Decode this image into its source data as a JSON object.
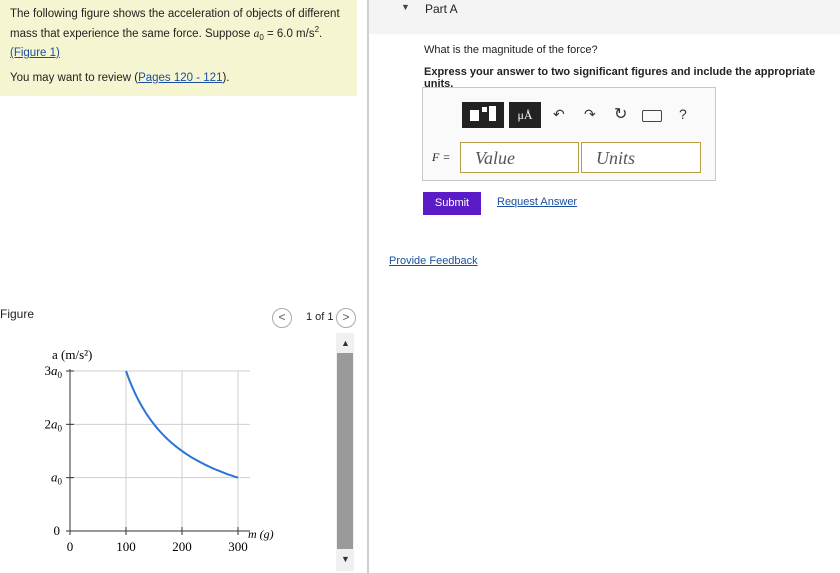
{
  "intro": {
    "line1": "The following figure shows the acceleration of objects of different",
    "line2a": "mass that experience the same force. Suppose ",
    "line2b": "a",
    "line2c": "0",
    "line2d": " = 6.0 m/s",
    "line2e": "2",
    "line2f": ".",
    "figure_link": "(Figure 1)",
    "review_pre": "You may want to review (",
    "review_link": "Pages 120 - 121",
    "review_post": ")."
  },
  "figure": {
    "label": "Figure",
    "prev": "<",
    "next": ">",
    "pager": "1 of 1",
    "scroll_up": "▲",
    "scroll_down": "▼"
  },
  "chart_data": {
    "type": "line",
    "ylabel": "a (m/s²)",
    "xlabel": "m (g)",
    "xticks": [
      "0",
      "100",
      "200",
      "300"
    ],
    "yticks": [
      "0",
      "a0",
      "2a0",
      "3a0"
    ],
    "xlim": [
      0,
      300
    ],
    "ylim_in_a0": [
      0,
      3
    ],
    "grid": true,
    "series_color": "#2a74d6",
    "x": [
      100,
      120,
      150,
      200,
      250,
      300
    ],
    "y_in_a0": [
      3.0,
      2.5,
      2.0,
      1.5,
      1.2,
      1.0
    ]
  },
  "part": {
    "title": "Part A",
    "collapse": "▼",
    "question": "What is the magnitude of the force?",
    "instruction": "Express your answer to two significant figures and include the appropriate units."
  },
  "toolbar": {
    "mu_label": "μÅ",
    "undo": "↶",
    "redo": "↷",
    "reset": "↻",
    "keyboard": "▭",
    "help": "?"
  },
  "answer": {
    "variable": "F =",
    "value_placeholder": "Value",
    "units_placeholder": "Units"
  },
  "actions": {
    "submit": "Submit",
    "request": "Request Answer",
    "feedback": "Provide Feedback"
  }
}
